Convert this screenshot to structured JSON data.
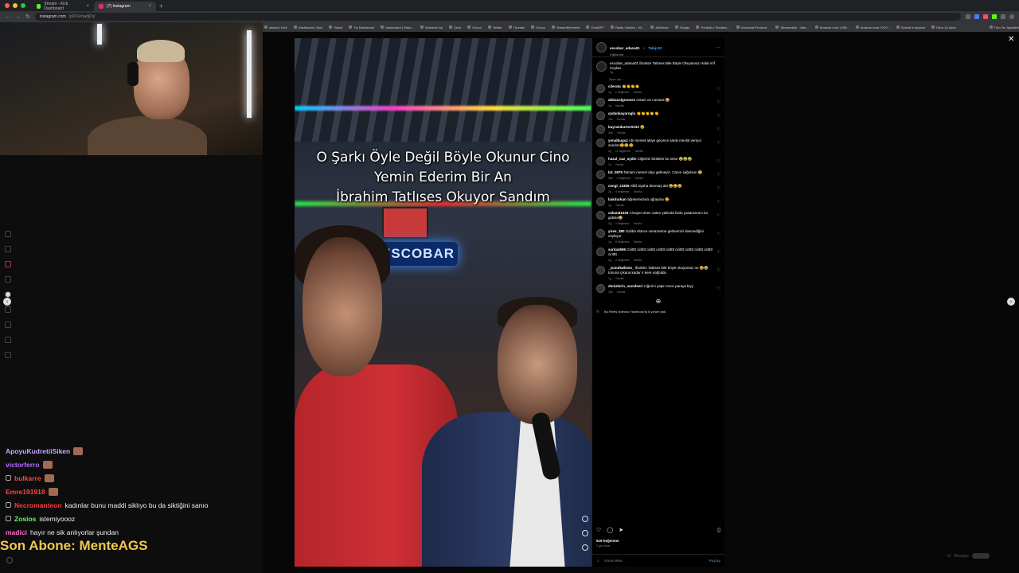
{
  "browser": {
    "tabs": [
      {
        "label": "Stream - Kick Dashboard",
        "active": false
      },
      {
        "label": "(7) Instagram",
        "active": true
      }
    ],
    "url_host": "instagram.com",
    "url_path": "/p/DXehw/jjPq/",
    "bookmarks": [
      "slenan | Kick",
      "Dashboard | Kick",
      "Twitch",
      "Tw Dashboard",
      "Dashboard | Strea...",
      "Streamer Ad",
      "Çevir",
      "iCloud",
      "Twitter",
      "Threads",
      "Ocucu",
      "StreamElements",
      "ChatGPT",
      "Radio Garden - Kli...",
      "AdSense",
      "Google",
      "Portfolio | Shutters...",
      "Universal Producti...",
      "Streamable - Vide...",
      "Amazon.com: USB...",
      "Amazon.com: KOV...",
      "Submit a request",
      "Drive & Listes"
    ],
    "bookmarks_right": "Tüm Yer İşaretleri"
  },
  "stream": {
    "chat": [
      {
        "user": "ApoyuKudretiiSiken",
        "color": "#c9a6ff",
        "msg": "",
        "emote": true
      },
      {
        "user": "victorferro",
        "color": "#b46cff",
        "msg": "",
        "emote": true
      },
      {
        "user": "bulkarre",
        "color": "#ff4444",
        "msg": "",
        "emote": true,
        "badge": true
      },
      {
        "user": "Emre191918",
        "color": "#ff4444",
        "msg": "",
        "emote": true
      },
      {
        "user": "Necromanteon",
        "color": "#ff3b3b",
        "msg": "kadınlar bunu maddi siklıyo bu da siktiğini sanıo",
        "badge": true
      },
      {
        "user": "Zosios",
        "color": "#5cff5c",
        "msg": "istemiyoooz",
        "badge": true
      },
      {
        "user": "madici",
        "color": "#ff6ec7",
        "msg": "hayır ne sik anlıyorlar şundan"
      }
    ],
    "sub_banner": "Son Abone: MenteAGS"
  },
  "video": {
    "overlay_lines": [
      "O Şarkı Öyle Değil Böyle Okunur Cino",
      "Yemin Ederim Bir An",
      "İbrahim Tatlıses Okuyor Sandım"
    ],
    "sign": "ESCOBAR"
  },
  "post": {
    "author": "escobar_adana01",
    "follow_label": "Takip Et",
    "sub_label": "Orijinal ses",
    "caption": "escobar_adana01 İbrahim Tatlıses Bile Böyle Okuyamaz Halal Arif Ceylan",
    "caption_time": "2g",
    "translate": "Senin için ···",
    "comments": [
      {
        "user": "cilerata",
        "text": "👏👏👏👏",
        "time": "1g",
        "likes": "1 beğenme",
        "reply": "Yanıtla"
      },
      {
        "user": "abbasolgnomez",
        "text": "Ortam on numara 😂",
        "time": "1g",
        "likes": "",
        "reply": "Yanıtla"
      },
      {
        "user": "aydankayaroglu",
        "text": "👏👏👏👏👏",
        "time": "19s",
        "likes": "",
        "reply": "Yanıtla"
      },
      {
        "user": "bayramkurter0233",
        "text": "😂",
        "time": "20s",
        "likes": "",
        "reply": "Yanıtla"
      },
      {
        "user": "yenalbuguz",
        "text": "Abi memet abiye geçince sanki mevlüt veriyor sandım😂😂😂",
        "time": "2g",
        "likes": "11 beğenme",
        "reply": "Yanıtla"
      },
      {
        "user": "hazal_naz_aydin",
        "text": "Ciğerimi biraktim bu sese 😂😂😂",
        "time": "1s",
        "likes": "",
        "reply": "Yanıtla"
      },
      {
        "user": "bd_0875",
        "text": "Tamam memet dayı gelmeyiz. Canın sağolsun 😂",
        "time": "18s",
        "likes": "2 beğenme",
        "reply": "Yanıtla"
      },
      {
        "user": "cengi_z3305",
        "text": "Albil siyaha dönmüş abi 😂😂😂",
        "time": "2g",
        "likes": "4 beğenme",
        "reply": "Yanıtla"
      },
      {
        "user": "bakiturkan",
        "text": "öğretemezsin uğraşma 😂",
        "time": "1g",
        "likes": "",
        "reply": "Yanıtla"
      },
      {
        "user": "ozkan81026",
        "text": "Cinayet olcen zaten yakinda fazla yasamazsın bu gidisle😂",
        "time": "2g",
        "likes": "3 beğenme",
        "reply": "Yanıtla"
      },
      {
        "user": "yiree_380",
        "text": "Galiba ölünce cenazesine gelmemizi istemediğini söylüyor",
        "time": "1g",
        "likes": "8 beğenme",
        "reply": "Yanıtla"
      },
      {
        "user": "sarita4595",
        "text": "Ciritttt ciritttt ciritttt ciritttt ciritttt ciritttt ciritttt ciritttt ciritttt ciritttt",
        "time": "2g",
        "likes": "2 beğenme",
        "reply": "Yanıtla"
      },
      {
        "user": "_yusuftatlises_",
        "text": "İbrahim Tatlıses bile böyle okuyamaz ne 😂😂 tonuna çıkana kadar 4 kere soğruldu",
        "time": "1g",
        "likes": "",
        "reply": "Yanıtla"
      },
      {
        "user": "denizlerin_sunvleeri",
        "text": "Ciğerini yapin önce paraya kiyy",
        "time": "15s",
        "likes": "",
        "reply": "Yanıtla"
      }
    ],
    "fb_note": "Bu Reels videosu Facebook'ta 6 yorum aldı.",
    "likes_count": "519 beğenme",
    "posted_ago": "2 gün önce",
    "comment_placeholder": "Yorum ekle...",
    "post_label": "Paylaş"
  },
  "misc": {
    "watermark": "Mesajlar"
  }
}
